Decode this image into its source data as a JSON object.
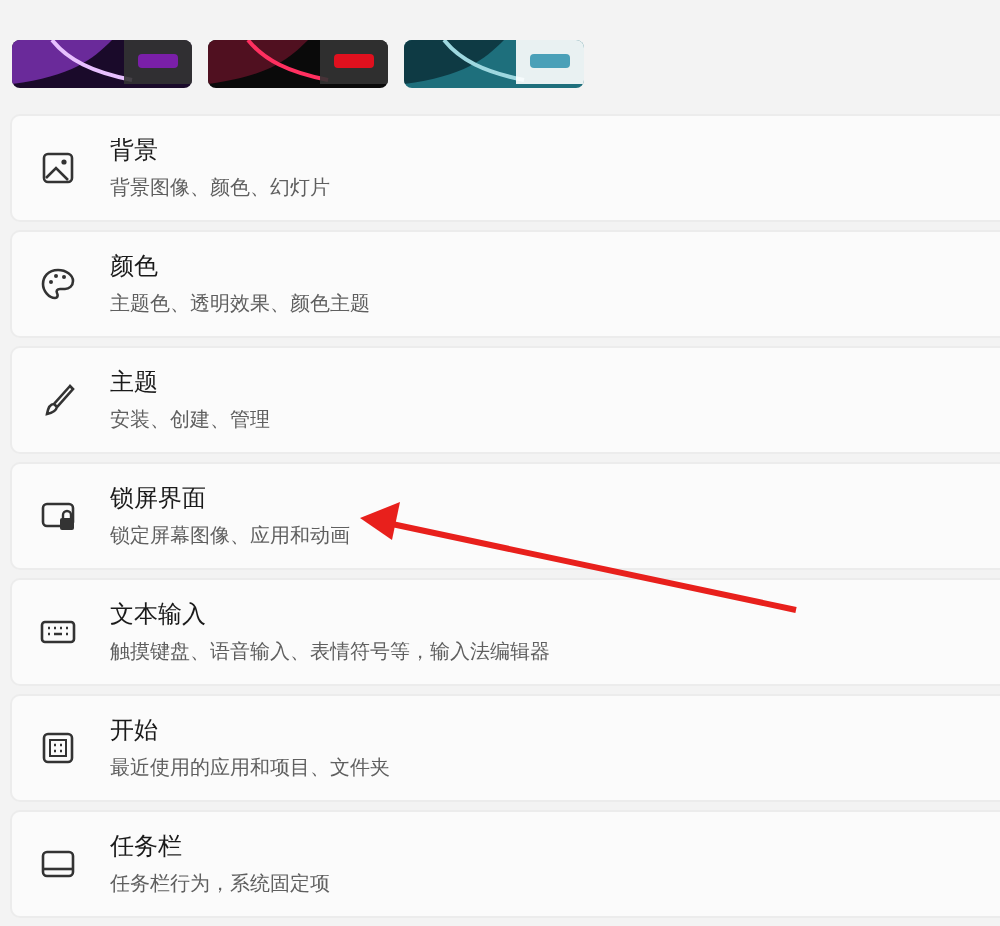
{
  "settings": [
    {
      "title": "背景",
      "subtitle": "背景图像、颜色、幻灯片"
    },
    {
      "title": "颜色",
      "subtitle": "主题色、透明效果、颜色主题"
    },
    {
      "title": "主题",
      "subtitle": "安装、创建、管理"
    },
    {
      "title": "锁屏界面",
      "subtitle": "锁定屏幕图像、应用和动画"
    },
    {
      "title": "文本输入",
      "subtitle": "触摸键盘、语音输入、表情符号等，输入法编辑器"
    },
    {
      "title": "开始",
      "subtitle": "最近使用的应用和项目、文件夹"
    },
    {
      "title": "任务栏",
      "subtitle": "任务栏行为，系统固定项"
    }
  ]
}
